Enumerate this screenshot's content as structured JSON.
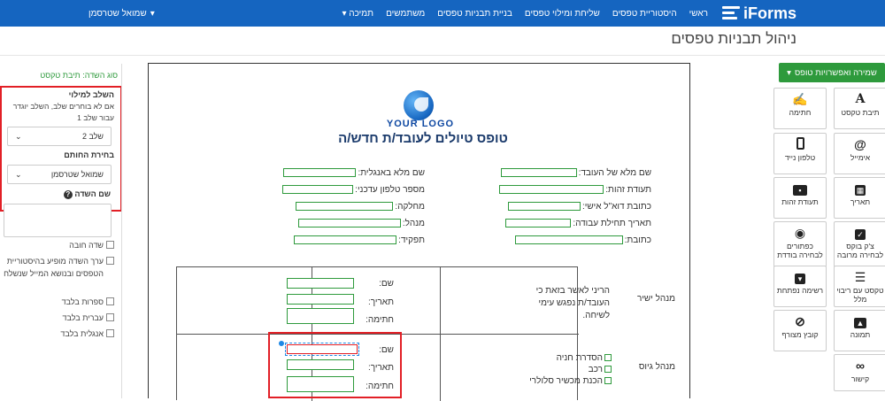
{
  "nav": {
    "logo": "iForms",
    "links": [
      "ראשי",
      "היסטוריית טפסים",
      "שליחת ומילוי טפסים",
      "בניית תבניות טפסים",
      "משתמשים",
      "תמיכה"
    ],
    "user": "שמואל שטרסמן"
  },
  "page_title": "ניהול תבניות טפסים",
  "left_panel": {
    "field_type": "סוג השדה: תיבת טקסט",
    "stage_label": "השלב למילוי",
    "stage_hint": "אם לא בוחרים שלב, השלב יוגדר עבור שלב 1",
    "stage_value": "שלב 2",
    "signer_label": "בחירת החותם",
    "signer_value": "שמואל שטרסמן",
    "field_name_label": "שם השדה",
    "required": "שדה חובה",
    "history_field": "ערך השדה מופיע בהיסטוריית הטפסים ובנושא המייל שנשלח",
    "digits_only": "ספרות בלבד",
    "hebrew_only": "עברית בלבד",
    "english_only": "אנגלית בלבד"
  },
  "doc": {
    "logo_text": "YOUR LOGO",
    "title": "טופס טיולים לעובד/ת חדש/ה",
    "right_fields": [
      "שם מלא של העובד:",
      "תעודת זהות:",
      "כתובת דוא\"ל אישי:",
      "תאריך תחילת עבודה:",
      "כתובת:"
    ],
    "left_fields": [
      "שם מלא באנגלית:",
      "מספר טלפון עדכני:",
      "מחלקה:",
      "מנהל:",
      "תפקיד:"
    ],
    "table": {
      "row1_role": "מנהל ישיר",
      "row1_text": "הריני לאשר בזאת כי העובד/ת נפגש עימי לשיחה.",
      "row2_role": "מנהל גיוס",
      "row2_items": [
        "הסדרת חניה",
        "רכב",
        "הכנת מכשיר סלולרי"
      ],
      "name": "שם:",
      "date": "תאריך:",
      "sign": "חתימה:"
    }
  },
  "right_panel": {
    "save_button": "שמירה ואפשרויות טופס",
    "tools": [
      {
        "label": "תיבת טקסט",
        "icon": "text-icon"
      },
      {
        "label": "חתימה",
        "icon": "signature-icon"
      },
      {
        "label": "אימייל",
        "icon": "at-icon"
      },
      {
        "label": "טלפון נייד",
        "icon": "phone-icon"
      },
      {
        "label": "תאריך",
        "icon": "calendar-icon"
      },
      {
        "label": "תעודת זהות",
        "icon": "id-card-icon"
      },
      {
        "label": "צ'ק בוקס לבחירה מרובה",
        "icon": "checkbox-icon"
      },
      {
        "label": "כפתורים לבחירה בודדת",
        "icon": "radio-icon"
      },
      {
        "label": "טקסט עם ריבוי מלל",
        "icon": "paragraph-icon"
      },
      {
        "label": "רשימה נפתחת",
        "icon": "dropdown-icon"
      },
      {
        "label": "תמונה",
        "icon": "image-icon"
      },
      {
        "label": "קובץ מצורף",
        "icon": "attachment-icon"
      },
      {
        "label": "קישור",
        "icon": "link-icon"
      }
    ]
  }
}
